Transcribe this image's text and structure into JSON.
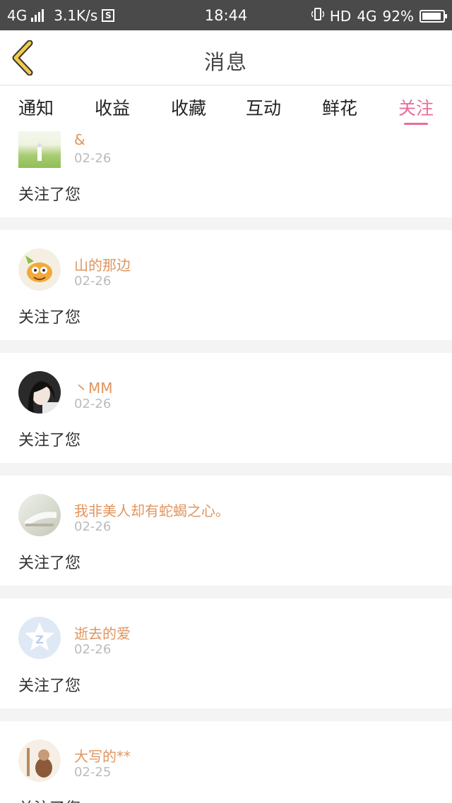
{
  "status_bar": {
    "network": "4G",
    "speed": "3.1K/s",
    "sim_badge": "S",
    "time": "18:44",
    "hd": "HD",
    "network_right": "4G",
    "battery_level": "92%"
  },
  "nav": {
    "title": "消息",
    "back_icon": "chevron-left-icon",
    "accent_color": "#f2c94c"
  },
  "tabs": [
    {
      "label": "通知"
    },
    {
      "label": "收益"
    },
    {
      "label": "收藏"
    },
    {
      "label": "互动"
    },
    {
      "label": "鲜花"
    },
    {
      "label": "关注",
      "active": true
    }
  ],
  "colors": {
    "active_tab": "#ea6c9b",
    "username": "#e0955e",
    "date": "#bbbbbb"
  },
  "messages": [
    {
      "name": "&",
      "date": "02-26",
      "text": "关注了您",
      "avatar": "landscape-photo"
    },
    {
      "name": "山的那边",
      "date": "02-26",
      "text": "关注了您",
      "avatar": "cartoon-character"
    },
    {
      "name": "丶MM",
      "date": "02-26",
      "text": "关注了您",
      "avatar": "girl-portrait"
    },
    {
      "name": "我非美人却有蛇蝎之心。",
      "date": "02-26",
      "text": "关注了您",
      "avatar": "soft-photo"
    },
    {
      "name": "逝去的爱",
      "date": "02-26",
      "text": "关注了您",
      "avatar": "default-z-avatar"
    },
    {
      "name": "大写的**",
      "date": "02-25",
      "text": "关注了您",
      "avatar": "figurine-photo"
    }
  ]
}
